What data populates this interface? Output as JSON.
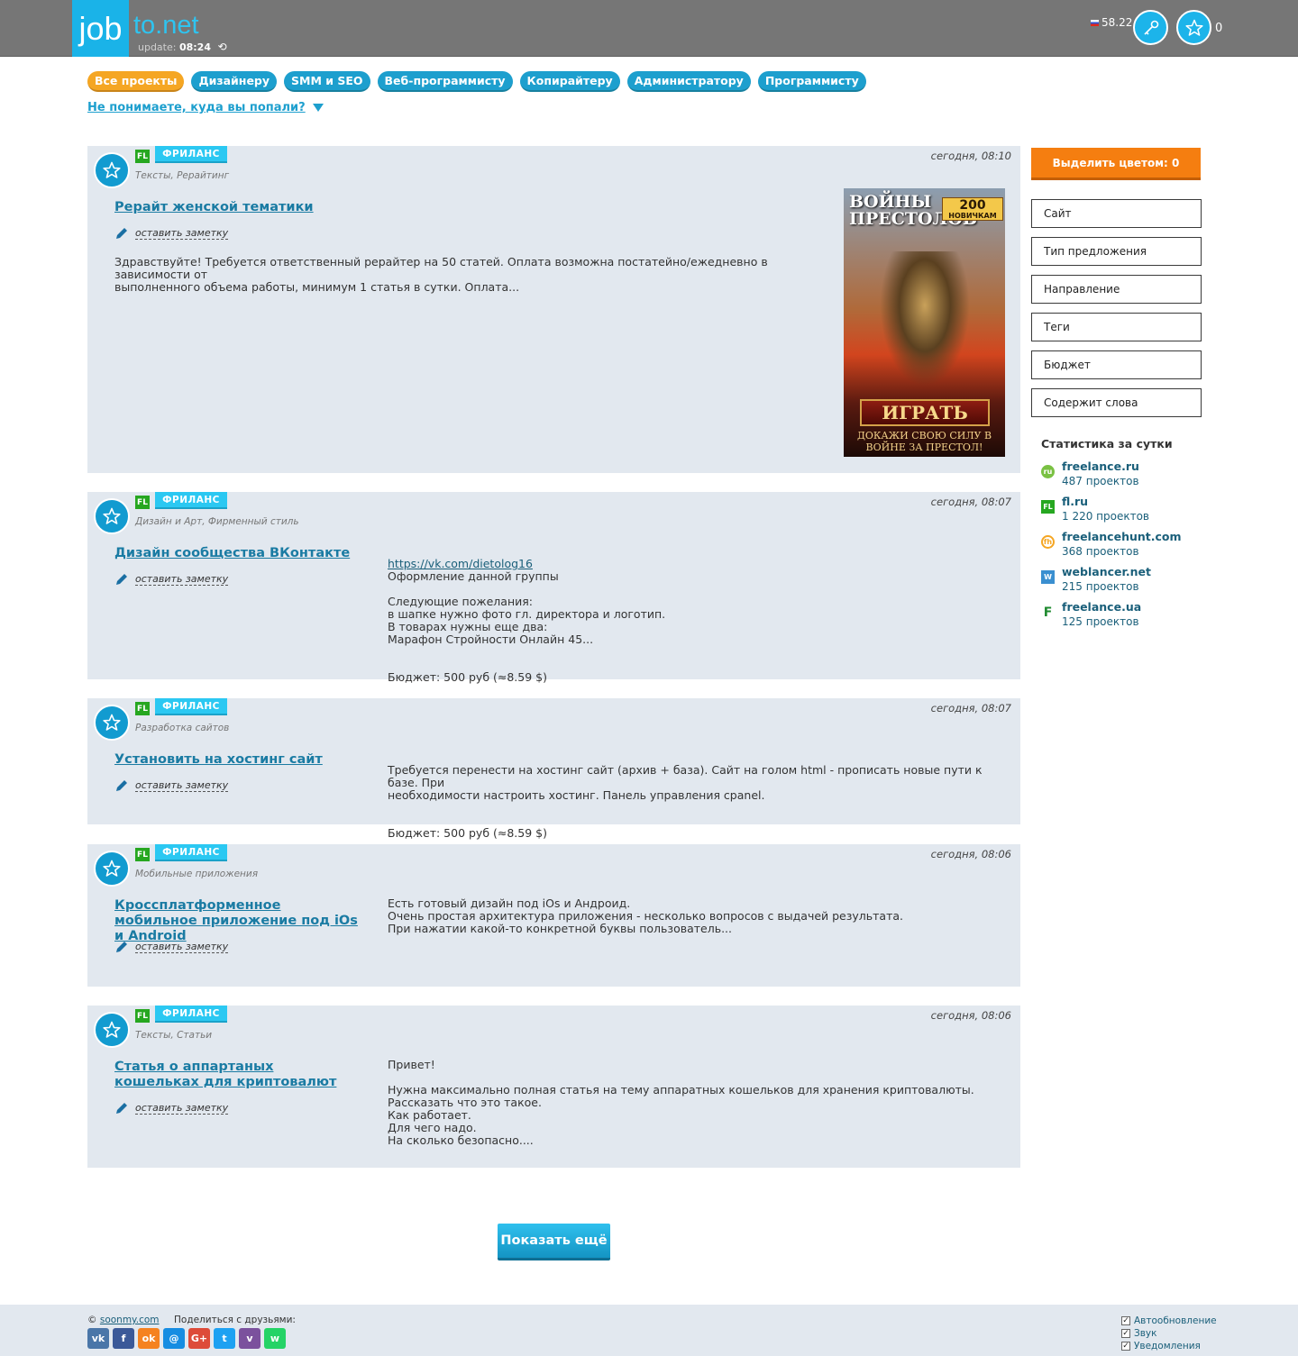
{
  "header": {
    "logo_job": "job",
    "logo_net": "to.net",
    "update_label": "update:",
    "update_time": "08:24",
    "rate": "58.22",
    "favorites_count": "0"
  },
  "nav": {
    "pills": [
      "Все проекты",
      "Дизайнеру",
      "SMM и SEO",
      "Веб-программисту",
      "Копирайтеру",
      "Администратору",
      "Программисту"
    ],
    "what_link": "Не понимаете, куда вы попали?"
  },
  "projects": [
    {
      "site": "FL",
      "tag": "ФРИЛАНС",
      "category": "Тексты, Рерайтинг",
      "time": "сегодня, 08:10",
      "title": "Рерайт женской тематики",
      "note": "оставить заметку",
      "description": "Здравствуйте! Требуется ответственный рерайтер на 50 статей. Оплата возможна постатейно/ежедневно в зависимости от\nвыполненного объема работы, минимум 1 статья в сутки. Оплата..."
    },
    {
      "site": "FL",
      "tag": "ФРИЛАНС",
      "category": "Дизайн и Арт, Фирменный стиль",
      "time": "сегодня, 08:07",
      "title": "Дизайн сообщества ВКонтакте",
      "note": "оставить заметку",
      "link": "https://vk.com/dietolog16",
      "description": "Оформление данной группы\n\nСледующие пожелания:\nв шапке нужно фото гл. директора и логотип.\nВ товарах нужны еще два:\nМарафон Стройности Онлайн 45...",
      "budget": "Бюджет: 500 руб (≈8.59 $)"
    },
    {
      "site": "FL",
      "tag": "ФРИЛАНС",
      "category": "Разработка сайтов",
      "time": "сегодня, 08:07",
      "title": "Установить на хостинг сайт",
      "note": "оставить заметку",
      "description": "Требуется перенести на хостинг сайт (архив + база). Сайт на голом html - прописать новые пути к базе. При\nнеобходимости настроить хостинг. Панель управления cpanel.",
      "budget": "Бюджет: 500 руб (≈8.59 $)"
    },
    {
      "site": "FL",
      "tag": "ФРИЛАНС",
      "category": "Мобильные приложения",
      "time": "сегодня, 08:06",
      "title": "Кроссплатформенное мобильное приложение под iOs и Android",
      "note": "оставить заметку",
      "description": "Есть готовый дизайн под iOs и Андроид.\nОчень простая архитектура приложения - несколько вопросов с выдачей результата.\nПри нажатии какой-то конкретной буквы пользователь..."
    },
    {
      "site": "FL",
      "tag": "ФРИЛАНС",
      "category": "Тексты, Статьи",
      "time": "сегодня, 08:06",
      "title": "Статья о аппартаных кошельках для криптовалют",
      "note": "оставить заметку",
      "description": "Привет!\n\nНужна максимально полная статья на тему аппаратных кошельков для хранения криптовалюты.\nРассказать что это такое.\nКак работает.\nДля чего надо.\nНа сколько безопасно...."
    }
  ],
  "ad": {
    "title": "ВОЙНЫ ПРЕСТОЛОВ",
    "badge_num": "200",
    "badge_text": "НОВИЧКАМ",
    "button": "ИГРАТЬ",
    "subtitle": "ДОКАЖИ СВОЮ СИЛУ В ВОЙНЕ ЗА ПРЕСТОЛ!"
  },
  "sidebar": {
    "highlight_button": "Выделить цветом: 0",
    "filters": [
      "Сайт",
      "Тип предложения",
      "Направление",
      "Теги",
      "Бюджет",
      "Содержит слова"
    ],
    "stats_title": "Статистика за сутки",
    "stats": [
      {
        "name": "freelance.ru",
        "count": "487 проектов",
        "icon": "ru",
        "color": "#7ac143"
      },
      {
        "name": "fl.ru",
        "count": "1 220 проектов",
        "icon": "FL",
        "color": "#26a720"
      },
      {
        "name": "freelancehunt.com",
        "count": "368 проектов",
        "icon": "fh",
        "color": "#f5a623"
      },
      {
        "name": "weblancer.net",
        "count": "215 проектов",
        "icon": "W",
        "color": "#3a8fd0"
      },
      {
        "name": "freelance.ua",
        "count": "125 проектов",
        "icon": "F",
        "color": "#1f8a2f"
      }
    ]
  },
  "show_more": "Показать ещё",
  "footer": {
    "copyright_symbol": "©",
    "copyright_link": "soonmy.com",
    "share_label": "Поделиться с друзьями:",
    "socials": [
      {
        "name": "vk",
        "label": "vk",
        "color": "#4a76a8"
      },
      {
        "name": "facebook",
        "label": "f",
        "color": "#3b5998"
      },
      {
        "name": "odnoklassniki",
        "label": "ok",
        "color": "#f58220"
      },
      {
        "name": "moimir",
        "label": "@",
        "color": "#168de2"
      },
      {
        "name": "googleplus",
        "label": "G+",
        "color": "#dd4b39"
      },
      {
        "name": "twitter",
        "label": "t",
        "color": "#1da1f2"
      },
      {
        "name": "viber",
        "label": "v",
        "color": "#7b519d"
      },
      {
        "name": "whatsapp",
        "label": "w",
        "color": "#25d366"
      }
    ],
    "options": [
      "Автообновление",
      "Звук",
      "Уведомления"
    ]
  }
}
